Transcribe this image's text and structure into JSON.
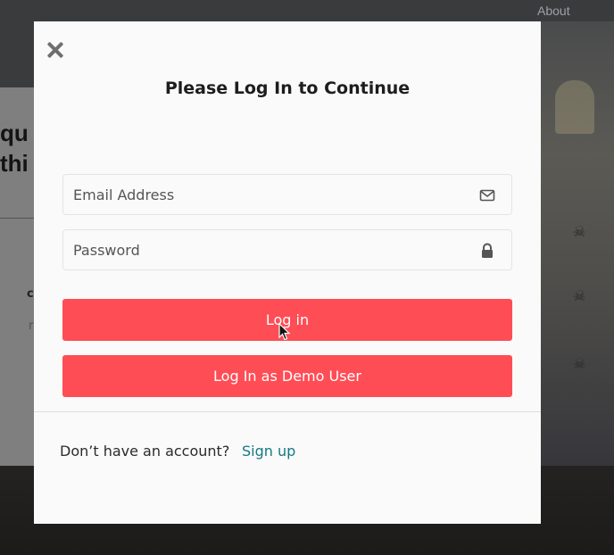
{
  "background": {
    "nav_about": "About",
    "heading_line1": "qu",
    "heading_line2": "thi",
    "small1": "c",
    "small2": "r"
  },
  "modal": {
    "title": "Please Log In to Continue",
    "close_icon": "close-icon",
    "email": {
      "placeholder": "Email Address",
      "value": "",
      "icon": "envelope-icon"
    },
    "password": {
      "placeholder": "Password",
      "value": "",
      "icon": "lock-icon"
    },
    "login_label": "Log in",
    "demo_label": "Log In as Demo User",
    "footer": {
      "prompt": "Don’t have an account?",
      "signup_label": "Sign up"
    }
  },
  "colors": {
    "primary_button": "#ff4d55",
    "link": "#147a82",
    "modal_bg": "#fafafa"
  }
}
